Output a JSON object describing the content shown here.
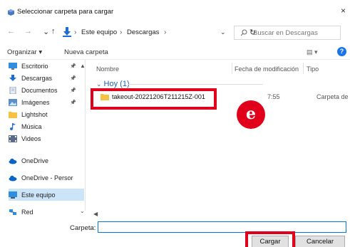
{
  "title_bar": {
    "title": "Seleccionar carpeta para cargar",
    "close_glyph": "×"
  },
  "navigation": {
    "back_glyph": "←",
    "forward_glyph": "→",
    "up_glyph": "↑",
    "crumb_sep": "›",
    "breadcrumbs": [
      "Este equipo",
      "Descargas"
    ],
    "dropdown_glyph": "⌄",
    "refresh_glyph": "↻",
    "search_placeholder": "Buscar en Descargas"
  },
  "toolbar": {
    "organize_label": "Organizar ▾",
    "new_folder_label": "Nueva carpeta",
    "view_glyph": "▤ ▾",
    "help_glyph": "?"
  },
  "sidebar": {
    "pin_glyph": "📌",
    "items": [
      {
        "label": "Escritorio",
        "icon": "desktop-icon",
        "pinned": true
      },
      {
        "label": "Descargas",
        "icon": "download-icon",
        "pinned": true
      },
      {
        "label": "Documentos",
        "icon": "documents-icon",
        "pinned": true
      },
      {
        "label": "Imágenes",
        "icon": "pictures-icon",
        "pinned": true
      },
      {
        "label": "Lightshot",
        "icon": "folder-icon",
        "pinned": false
      },
      {
        "label": "Música",
        "icon": "music-icon",
        "pinned": false
      },
      {
        "label": "Videos",
        "icon": "videos-icon",
        "pinned": false
      },
      {
        "label": "OneDrive",
        "icon": "cloud-icon",
        "pinned": false
      },
      {
        "label": "OneDrive - Persor",
        "icon": "cloud-icon",
        "pinned": false
      },
      {
        "label": "Este equipo",
        "icon": "computer-icon",
        "pinned": false,
        "selected": true
      },
      {
        "label": "Red",
        "icon": "network-icon",
        "pinned": false
      }
    ]
  },
  "columns": {
    "name": "Nombre",
    "modified": "Fecha de modificación",
    "type": "Tipo"
  },
  "group": {
    "label": "Hoy (1)",
    "collapse_glyph": "⌄"
  },
  "files": [
    {
      "name": "takeout-20221206T211215Z-001",
      "modified": "7:55",
      "type": "Carpeta de ar"
    }
  ],
  "annotation": {
    "badge": "e"
  },
  "footer": {
    "folder_label": "Carpeta:",
    "folder_value": "",
    "upload_button": "Cargar",
    "cancel_button": "Cancelar"
  },
  "colors": {
    "accent": "#0078d7",
    "highlight": "#e0001b",
    "selected_bg": "#cce4f7",
    "folder": "#f5c242"
  }
}
